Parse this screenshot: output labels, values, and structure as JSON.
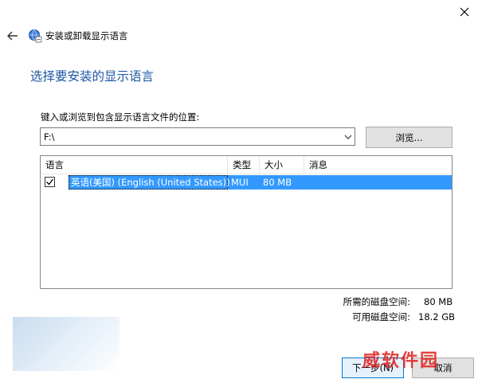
{
  "window": {
    "title": "安装或卸载显示语言"
  },
  "page": {
    "heading": "选择要安装的显示语言"
  },
  "path": {
    "label": "键入或浏览到包含显示语言文件的位置:",
    "value": "F:\\"
  },
  "browse_label": "浏览...",
  "list": {
    "headers": [
      "语言",
      "类型",
      "大小",
      "消息"
    ],
    "rows": [
      {
        "checked": true,
        "language": "英语(美国) (English (United States))",
        "type": "MUI",
        "size": "80 MB",
        "message": ""
      }
    ]
  },
  "space": {
    "required_label": "所需的磁盘空间:",
    "required_value": "80 MB",
    "available_label": "可用磁盘空间:",
    "available_value": "18.2 GB"
  },
  "buttons": {
    "next": "下一步(N)",
    "cancel": "取消"
  },
  "watermark": "威软件园",
  "colors": {
    "accent": "#1a57a4",
    "selection": "#3399ff"
  }
}
